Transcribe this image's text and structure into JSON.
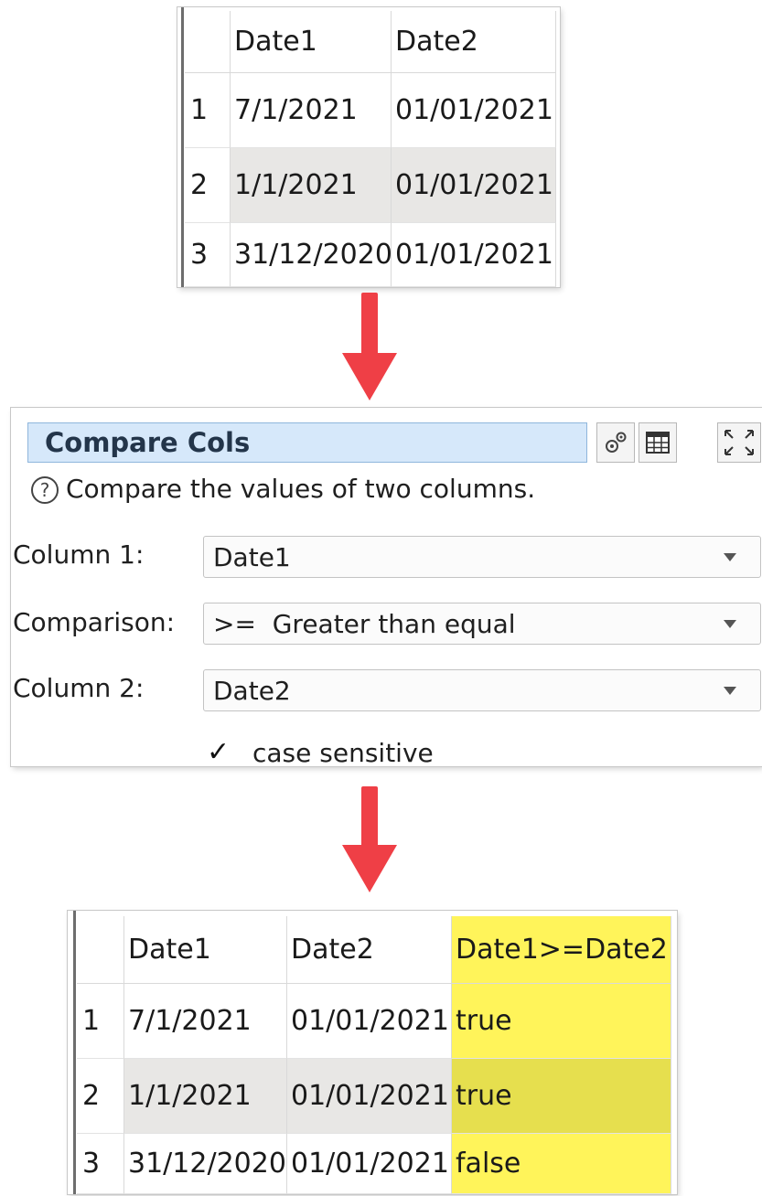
{
  "input_table": {
    "columns": [
      "",
      "Date1",
      "Date2"
    ],
    "rows": [
      [
        "1",
        "7/1/2021",
        "01/01/2021"
      ],
      [
        "2",
        "1/1/2021",
        "01/01/2021"
      ],
      [
        "3",
        "31/12/2020",
        "01/01/2021"
      ]
    ]
  },
  "dialog": {
    "title": "Compare Cols",
    "description": "Compare the values of two columns.",
    "help_glyph": "?",
    "column1": {
      "label": "Column 1:",
      "value": "Date1"
    },
    "comparison": {
      "label": "Comparison:",
      "value": ">=  Greater than equal"
    },
    "column2": {
      "label": "Column 2:",
      "value": "Date2"
    },
    "case_sensitive": {
      "label": "case sensitive",
      "checked": true,
      "check_glyph": "✓"
    },
    "icons": [
      "gears-icon",
      "table-icon",
      "maximize-icon"
    ]
  },
  "output_table": {
    "columns": [
      "",
      "Date1",
      "Date2",
      "Date1>=Date2"
    ],
    "rows": [
      [
        "1",
        "7/1/2021",
        "01/01/2021",
        "true"
      ],
      [
        "2",
        "1/1/2021",
        "01/01/2021",
        "true"
      ],
      [
        "3",
        "31/12/2020",
        "01/01/2021",
        "false"
      ]
    ]
  },
  "colors": {
    "arrow": "#ef3f46",
    "result_column": "#fff45a",
    "alt_row": "#e8e7e5",
    "title_bar": "#d6e8fa"
  }
}
